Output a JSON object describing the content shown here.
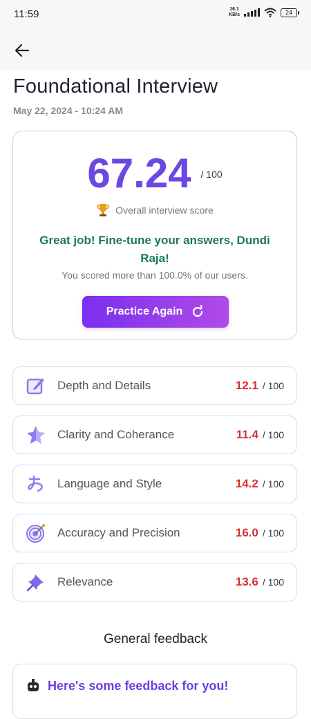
{
  "status": {
    "time": "11:59",
    "net_speed_value": "16.1",
    "net_speed_unit": "KB/s",
    "battery": "24"
  },
  "header": {
    "title": "Foundational Interview",
    "datetime": "May 22, 2024 - 10:24 AM"
  },
  "score": {
    "value": "67.24",
    "max": "/ 100",
    "overall_label": "Overall interview score",
    "message": "Great job! Fine-tune your answers, Dundi Raja!",
    "percentile_text": "You scored more than 100.0% of our users.",
    "practice_label": "Practice Again"
  },
  "metrics": [
    {
      "label": "Depth and Details",
      "score": "12.1",
      "max": "/ 100",
      "icon": "edit-square-icon"
    },
    {
      "label": "Clarity and Coherance",
      "score": "11.4",
      "max": "/ 100",
      "icon": "star-icon"
    },
    {
      "label": "Language and Style",
      "score": "14.2",
      "max": "/ 100",
      "icon": "language-glyph-icon"
    },
    {
      "label": "Accuracy and Precision",
      "score": "16.0",
      "max": "/ 100",
      "icon": "target-icon"
    },
    {
      "label": "Relevance",
      "score": "13.6",
      "max": "/ 100",
      "icon": "pushpin-icon"
    }
  ],
  "feedback": {
    "section_title": "General feedback",
    "card_title": "Here's some feedback for you!"
  },
  "colors": {
    "score_gradient": "#6c48e3",
    "message_green": "#1a7a4f",
    "metric_score_red": "#d63030",
    "button_gradient_start": "#7a2ff0",
    "button_gradient_end": "#b04be8"
  }
}
